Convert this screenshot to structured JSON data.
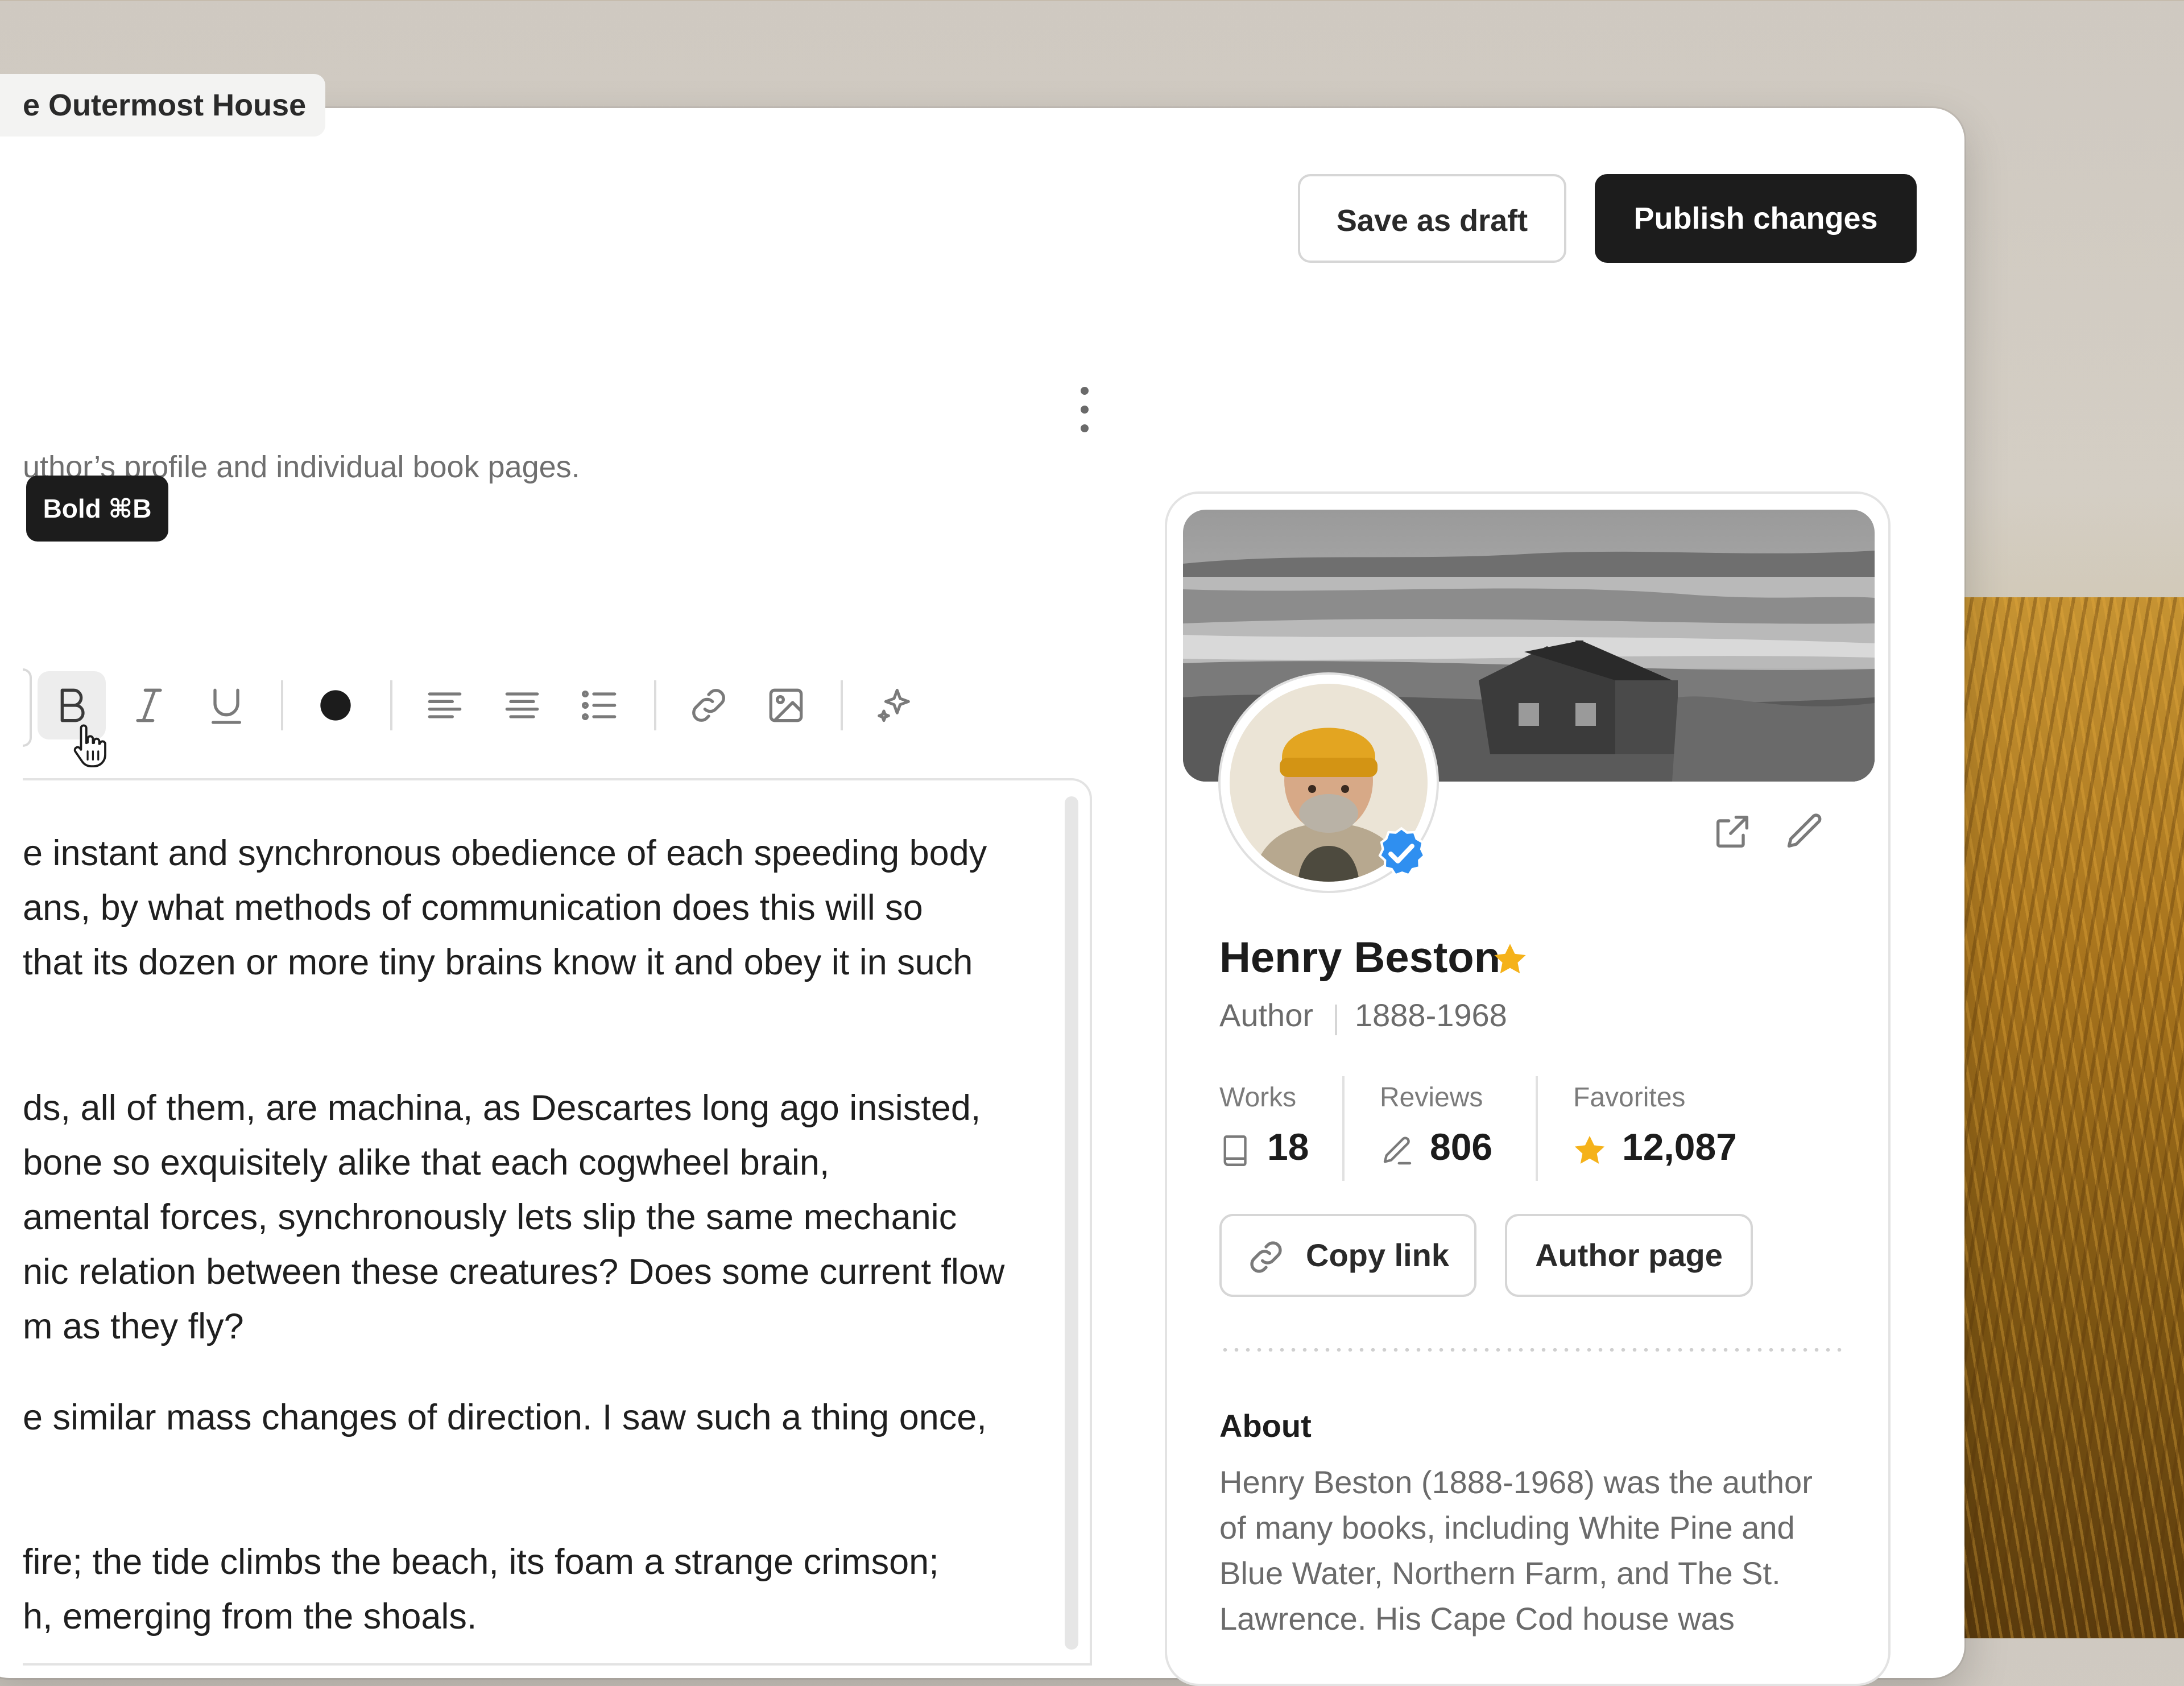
{
  "header": {
    "breadcrumb": "e Outermost House",
    "save_draft_label": "Save as draft",
    "publish_label": "Publish changes"
  },
  "editor": {
    "hint": "uthor’s profile and individual book pages.",
    "tooltip": "Bold ⌘B",
    "toolbar_icons": [
      "bold-icon",
      "italic-icon",
      "underline-icon",
      "color-dot-icon",
      "align-left-icon",
      "align-center-icon",
      "bullet-list-icon",
      "link-icon",
      "image-icon",
      "sparkle-icon"
    ],
    "paragraphs": [
      [
        "e instant and synchronous obedience of each speeding body",
        "ans, by what methods of communication does this will so",
        "that its dozen or more tiny brains know it and obey it in such"
      ],
      [
        "ds, all of them, are machina, as Descartes long ago insisted,",
        " bone so exquisitely alike that each cogwheel brain,",
        "amental forces, synchronously lets slip the same mechanic",
        "nic relation between these creatures? Does some current flow",
        "m as they fly?"
      ],
      [
        "e similar mass changes of direction. I saw such a thing once,"
      ],
      [
        " fire; the tide climbs the beach, its foam a strange crimson;",
        "h, emerging from the shoals."
      ]
    ]
  },
  "profile": {
    "name": "Henry Beston",
    "role": "Author",
    "years": "1888-1968",
    "stats": {
      "works_label": "Works",
      "works_value": "18",
      "reviews_label": "Reviews",
      "reviews_value": "806",
      "favorites_label": "Favorites",
      "favorites_value": "12,087"
    },
    "copy_link_label": "Copy link",
    "author_page_label": "Author page",
    "about_heading": "About",
    "about_lines": [
      "Henry Beston (1888-1968) was the author",
      "of many books, including White Pine and",
      "Blue Water, Northern Farm, and The St.",
      "Lawrence. His Cape Cod house was"
    ]
  },
  "colors": {
    "primary_button": "#1c1c1c",
    "star": "#f5b21a",
    "verified": "#2f8ff0"
  }
}
